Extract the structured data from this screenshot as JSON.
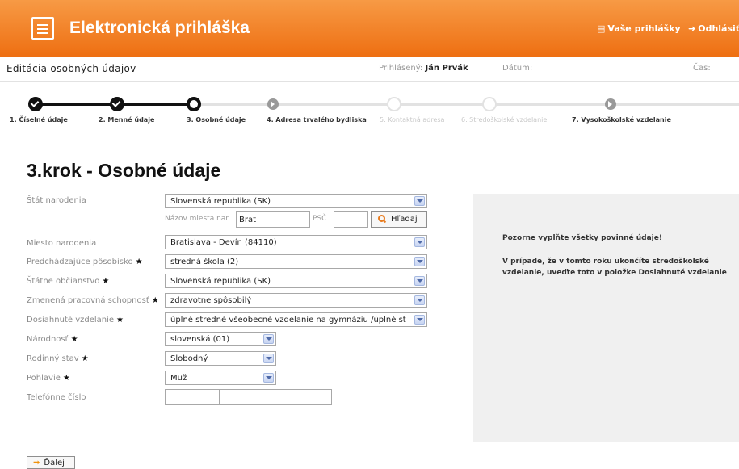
{
  "app": {
    "title": "Elektronická prihláška"
  },
  "header": {
    "applications_link": "Vaše prihlášky",
    "logout_link": "Odhlásiť"
  },
  "subheader": {
    "page_title": "Editácia osobných údajov",
    "logged_label": "Prihlásený:",
    "logged_user": "Ján Prvák",
    "date_label": "Dátum:",
    "time_label": "Čas:"
  },
  "steps": [
    {
      "label": "1. Číselné údaje",
      "state": "done"
    },
    {
      "label": "2. Menné údaje",
      "state": "done"
    },
    {
      "label": "3. Osobné údaje",
      "state": "current"
    },
    {
      "label": "4. Adresa trvalého bydliska",
      "state": "available"
    },
    {
      "label": "5. Kontaktná adresa",
      "state": "disabled"
    },
    {
      "label": "6. Stredoškolské vzdelanie",
      "state": "disabled"
    },
    {
      "label": "7. Vysokoškolské vzdelanie",
      "state": "available"
    }
  ],
  "heading": "3.krok - Osobné údaje",
  "form": {
    "birth_country": {
      "label": "Štát narodenia",
      "value": "Slovenská republika (SK)"
    },
    "birth_place_name": {
      "label": "Názov miesta nar.",
      "value": "Brat"
    },
    "psc": {
      "label": "PSČ",
      "value": ""
    },
    "search_button": "Hľadaj",
    "birth_place": {
      "label": "Miesto narodenia",
      "value": "Bratislava - Devín (84110)"
    },
    "previous_residence": {
      "label": "Predchádzajúce pôsobisko",
      "value": "stredná škola (2)"
    },
    "citizenship": {
      "label": "Štátne občianstvo",
      "value": "Slovenská republika (SK)"
    },
    "work_capacity": {
      "label": "Zmenená pracovná schopnosť",
      "value": "zdravotne spôsobilý"
    },
    "education": {
      "label": "Dosiahnuté vzdelanie",
      "value": "úplné stredné všeobecné vzdelanie na gymnáziu /úplné st"
    },
    "nationality": {
      "label": "Národnosť",
      "value": "slovenská (01)"
    },
    "marital_status": {
      "label": "Rodinný stav",
      "value": "Slobodný"
    },
    "sex": {
      "label": "Pohlavie",
      "value": "Muž"
    },
    "phone": {
      "label": "Telefónne číslo",
      "prefix": "",
      "number": ""
    },
    "required_mark": "★"
  },
  "info": {
    "line1": "Pozorne vyplňte všetky povinné údaje!",
    "line2": "V prípade, že v tomto roku ukončíte stredoškolské vzdelanie, uveďte toto v položke Dosiahnuté vzdelanie"
  },
  "next_button": "Ďalej",
  "colors": {
    "header_top": "#f79a45",
    "header_bottom": "#ee6f12",
    "panel": "#f0f0f0"
  }
}
